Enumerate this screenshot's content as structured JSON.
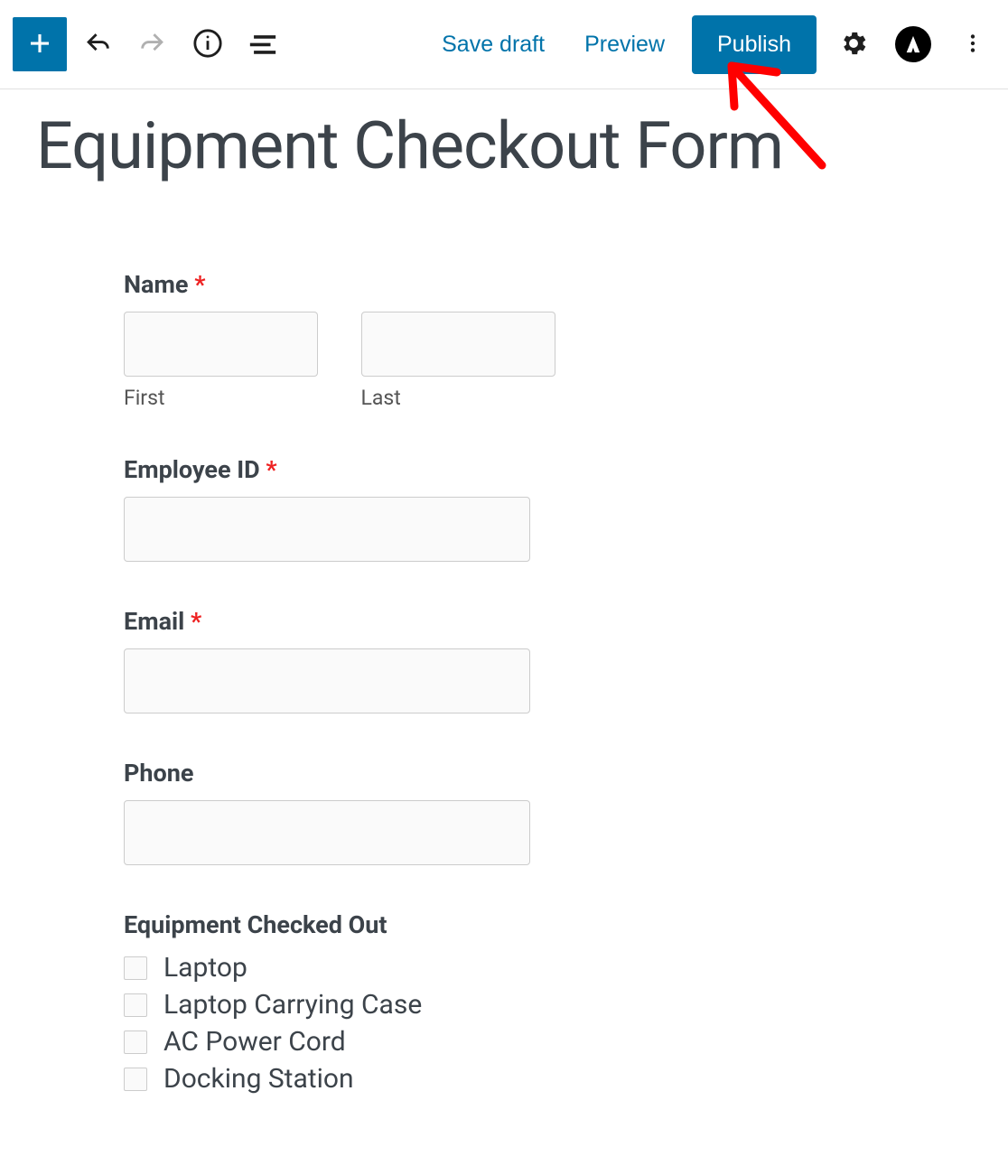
{
  "toolbar": {
    "save_draft": "Save draft",
    "preview": "Preview",
    "publish": "Publish"
  },
  "page": {
    "title": "Equipment Checkout Form"
  },
  "form": {
    "name": {
      "label": "Name",
      "first": {
        "label": "First",
        "value": ""
      },
      "last": {
        "label": "Last",
        "value": ""
      }
    },
    "employee_id": {
      "label": "Employee ID",
      "value": ""
    },
    "email": {
      "label": "Email",
      "value": ""
    },
    "phone": {
      "label": "Phone",
      "value": ""
    },
    "equipment": {
      "label": "Equipment Checked Out",
      "options": [
        "Laptop",
        "Laptop Carrying Case",
        "AC Power Cord",
        "Docking Station"
      ]
    }
  }
}
